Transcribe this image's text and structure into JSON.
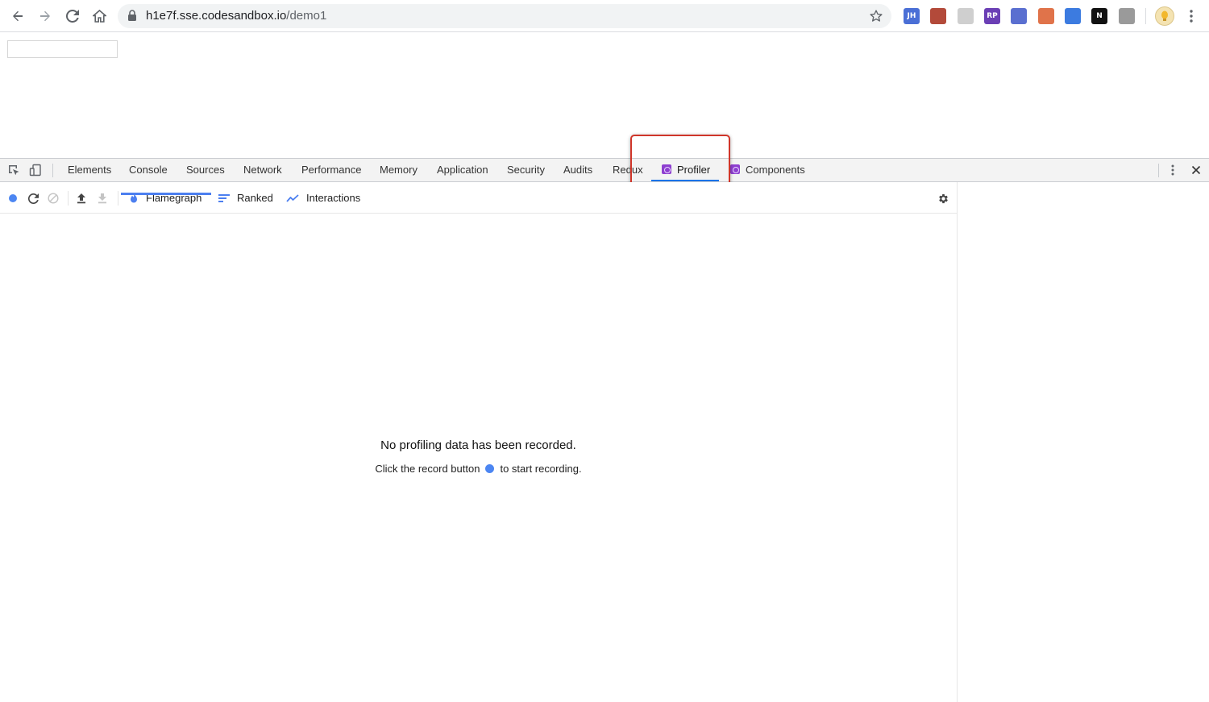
{
  "browser": {
    "url_host": "h1e7f.sse.codesandbox.io",
    "url_path": "/demo1",
    "extensions": [
      {
        "name": "jh-extension-icon",
        "label": "JH",
        "color": "#4a6fd6"
      },
      {
        "name": "redux-extension-icon",
        "label": "",
        "color": "#b34a3a"
      },
      {
        "name": "timer-extension-icon",
        "label": "",
        "color": "#cfcfcf"
      },
      {
        "name": "rp-extension-icon",
        "label": "RP",
        "color": "#6b3fb5"
      },
      {
        "name": "globe-extension-icon",
        "label": "",
        "color": "#5a6fd0"
      },
      {
        "name": "tree-extension-icon",
        "label": "",
        "color": "#e0734a"
      },
      {
        "name": "asterisk-extension-icon",
        "label": "",
        "color": "#3c7be0"
      },
      {
        "name": "notion-extension-icon",
        "label": "N",
        "color": "#111111"
      },
      {
        "name": "puzzle-extension-icon",
        "label": "",
        "color": "#9a9a9a"
      }
    ]
  },
  "devtools": {
    "tabs": [
      {
        "label": "Elements"
      },
      {
        "label": "Console"
      },
      {
        "label": "Sources"
      },
      {
        "label": "Network"
      },
      {
        "label": "Performance"
      },
      {
        "label": "Memory"
      },
      {
        "label": "Application"
      },
      {
        "label": "Security"
      },
      {
        "label": "Audits"
      },
      {
        "label": "Redux"
      },
      {
        "label": "Profiler",
        "active": true
      },
      {
        "label": "Components"
      }
    ],
    "accent_color": "#1a73e8",
    "highlight_color": "#d0362a"
  },
  "profiler": {
    "views": [
      {
        "label": "Flamegraph",
        "active": true
      },
      {
        "label": "Ranked"
      },
      {
        "label": "Interactions"
      }
    ],
    "empty_title": "No profiling data has been recorded.",
    "empty_sub_before": "Click the record button",
    "empty_sub_after": "to start recording.",
    "record_color": "#4c86f2"
  }
}
